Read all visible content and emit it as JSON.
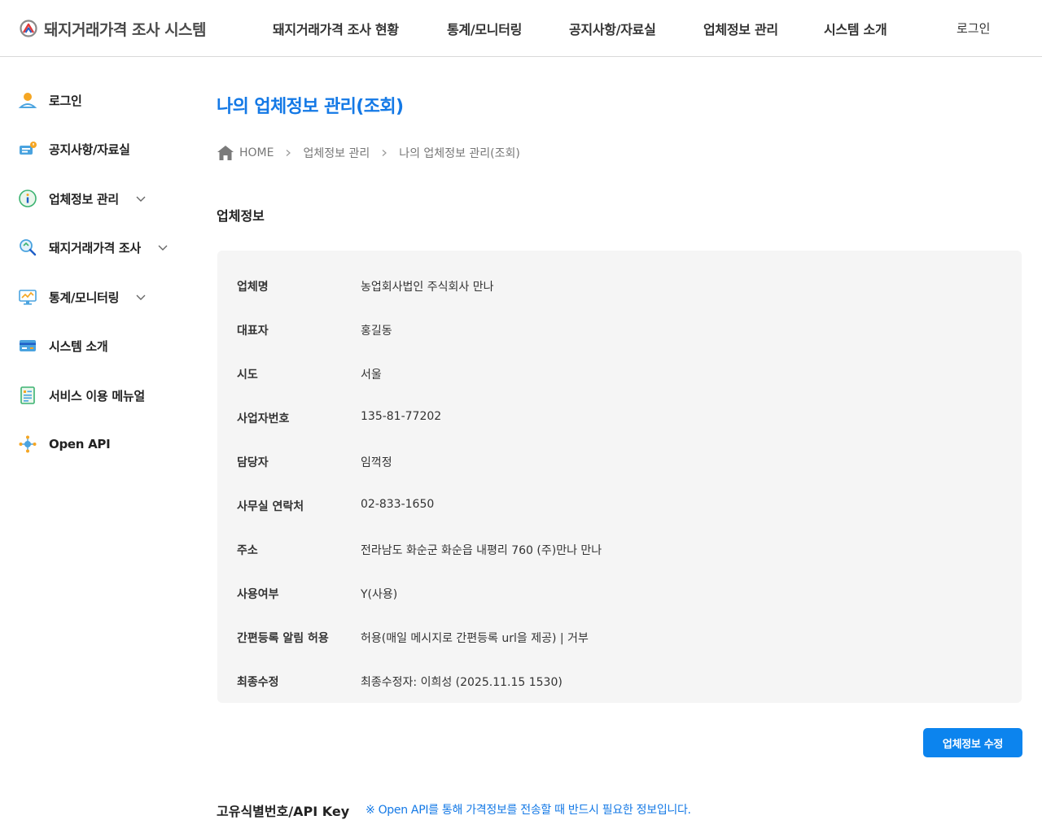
{
  "header": {
    "logo_text": "돼지거래가격 조사 시스템",
    "nav": [
      {
        "label": "돼지거래가격 조사 현황"
      },
      {
        "label": "통계/모니터링"
      },
      {
        "label": "공지사항/자료실"
      },
      {
        "label": "업체정보 관리"
      },
      {
        "label": "시스템 소개"
      }
    ],
    "login_label": "로그인"
  },
  "sidebar": {
    "items": [
      {
        "label": "로그인",
        "icon": "user-icon",
        "has_dropdown": false
      },
      {
        "label": "공지사항/자료실",
        "icon": "notice-icon",
        "has_dropdown": false
      },
      {
        "label": "업체정보 관리",
        "icon": "info-icon",
        "has_dropdown": true
      },
      {
        "label": "돼지거래가격 조사",
        "icon": "search-icon",
        "has_dropdown": true
      },
      {
        "label": "통계/모니터링",
        "icon": "monitor-chart-icon",
        "has_dropdown": true
      },
      {
        "label": "시스템 소개",
        "icon": "card-icon",
        "has_dropdown": false
      },
      {
        "label": "서비스 이용 메뉴얼",
        "icon": "manual-icon",
        "has_dropdown": false
      },
      {
        "label": "Open API",
        "icon": "network-icon",
        "has_dropdown": false
      }
    ]
  },
  "main": {
    "title": "나의 업체정보 관리(조회)",
    "breadcrumb": [
      "HOME",
      "업체정보 관리",
      "나의 업체정보 관리(조회)"
    ],
    "section_title": "업체정보",
    "info_rows": [
      {
        "label": "업체명",
        "value": "농업회사법인 주식회사 만나"
      },
      {
        "label": "대표자",
        "value": "홍길동"
      },
      {
        "label": "시도",
        "value": "서울"
      },
      {
        "label": "사업자번호",
        "value": "135-81-77202"
      },
      {
        "label": "담당자",
        "value": "임꺽정"
      },
      {
        "label": "사무실 연락처",
        "value": "02-833-1650"
      },
      {
        "label": "주소",
        "value": "전라남도 화순군 화순읍 내평리 760 (주)만나 만나"
      },
      {
        "label": "사용여부",
        "value": "Y(사용)"
      },
      {
        "label": "간편등록 알림 허용",
        "value": "허용(매일 메시지로 간편등록 url을 제공) | 거부"
      },
      {
        "label": "최종수정",
        "value": "최종수정자: 이희성 (2025.11.15 1530)"
      }
    ],
    "edit_button_label": "업체정보 수정",
    "apikey_title": "고유식별번호/API Key",
    "apikey_note": "※ Open API를 통해 가격정보를 전송할 때 반드시 필요한 정보입니다."
  },
  "colors": {
    "accent": "#1479e6",
    "button": "#0c84ee",
    "panel_bg": "#f5f5f5"
  }
}
